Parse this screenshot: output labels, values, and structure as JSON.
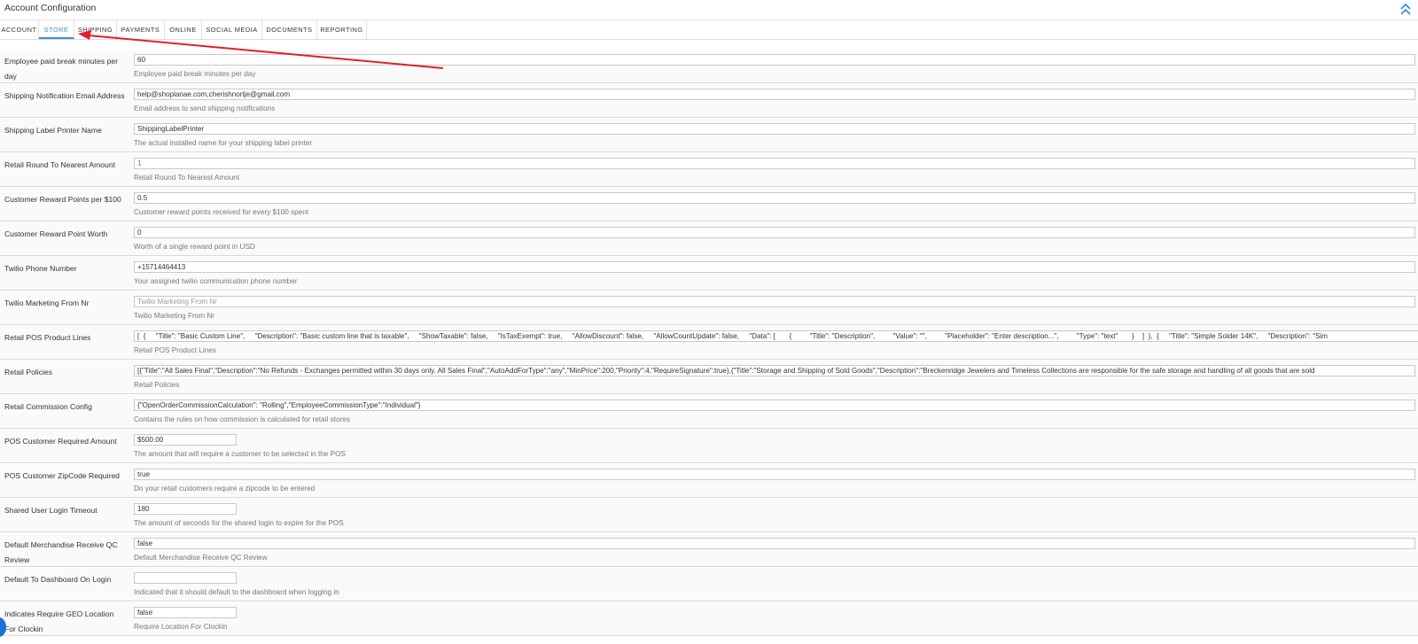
{
  "header": {
    "title": "Account Configuration"
  },
  "tabs": [
    {
      "label": "ACCOUNT"
    },
    {
      "label": "STORE"
    },
    {
      "label": "SHIPPING"
    },
    {
      "label": "PAYMENTS"
    },
    {
      "label": "ONLINE"
    },
    {
      "label": "SOCIAL MEDIA"
    },
    {
      "label": "DOCUMENTS"
    },
    {
      "label": "REPORTING"
    }
  ],
  "active_tab": "STORE",
  "colors": {
    "accent": "#3f8fd3",
    "annotation_arrow": "#e0202a"
  },
  "rows": [
    {
      "label": "Employee paid break minutes per day",
      "value": "60",
      "placeholder": "",
      "help": "Employee paid break minutes per day"
    },
    {
      "label": "Shipping Notification Email Address",
      "value": "help@shoplanae.com,cherishnortje@gmail.com",
      "placeholder": "",
      "help": "Email address to send shipping notifications"
    },
    {
      "label": "Shipping Label Printer Name",
      "value": "ShippingLabelPrinter",
      "placeholder": "",
      "help": "The actual installed name for your shipping label printer"
    },
    {
      "label": "Retail Round To Nearest Amount",
      "value": "1",
      "placeholder": "",
      "help": "Retail Round To Nearest Amount"
    },
    {
      "label": "Customer Reward Points per $100",
      "value": "0.5",
      "placeholder": "",
      "help": "Customer reward points received for every $100 spent"
    },
    {
      "label": "Customer Reward Point Worth",
      "value": "0",
      "placeholder": "",
      "help": "Worth of a single reward point in USD"
    },
    {
      "label": "Twilio Phone Number",
      "value": "+15714464413",
      "placeholder": "",
      "help": "Your assigned twilio communication phone number"
    },
    {
      "label": "Twilio Marketing From Nr",
      "value": "",
      "placeholder": "Twilio Marketing From Nr",
      "help": "Twilio Marketing From Nr"
    },
    {
      "label": "Retail POS Product Lines",
      "value": "[  {     \"Title\": \"Basic Custom Line\",     \"Description\": \"Basic custom line that is taxable\",     \"ShowTaxable\": false,     \"IsTaxExempt\": true,     \"AllowDiscount\": false,     \"AllowCountUpdate\": false,     \"Data\": [       {         \"Title\": \"Description\",         \"Value\": \"\",         \"Placeholder\": \"Enter description...\",         \"Type\": \"text\"       }    ]  },  {     \"Title\": \"Simple Solder 14K\",     \"Description\": \"Sim",
      "placeholder": "",
      "help": "Retail POS Product Lines"
    },
    {
      "label": "Retail Policies",
      "value": "[{\"Title\":\"All Sales Final\",\"Description\":\"No Refunds - Exchanges permitted within 30 days only. All Sales Final\",\"AutoAddForType\":\"any\",\"MinPrice\":200,\"Priority\":4,\"RequireSignature\":true},{\"Title\":\"Storage and Shipping of Sold Goods\",\"Description\":\"Breckenridge Jewelers and Timeless Collections are responsible for the safe storage and handling of all goods that are sold",
      "placeholder": "",
      "help": "Retail Policies"
    },
    {
      "label": "Retail Commission Config",
      "value": "{\"OpenOrderCommissionCalculation\": \"Rolling\",\"EmployeeCommissionType\":\"Individual\"}",
      "placeholder": "",
      "help": "Contains the rules on how commission is calculated for retail stores"
    },
    {
      "label": "POS Customer Required Amount",
      "value": "$500.00",
      "placeholder": "",
      "help": "The amount that will require a customer to be selected in the POS"
    },
    {
      "label": "POS Customer ZipCode Required",
      "value": "true",
      "placeholder": "",
      "help": "Do your retail customers require a zipcode to be entered"
    },
    {
      "label": "Shared User Login Timeout",
      "value": "180",
      "placeholder": "",
      "help": "The amount of seconds for the shared login to expire for the POS"
    },
    {
      "label": "Default Merchandise Receive QC Review",
      "value": "false",
      "placeholder": "",
      "help": "Default Merchandise Receive QC Review"
    },
    {
      "label": "Default To Dashboard On Login",
      "value": "",
      "placeholder": "",
      "help": "Indicated that it should default to the dashboard when logging in"
    },
    {
      "label": "Indicates Require GEO Location For Clockin",
      "value": "false",
      "placeholder": "",
      "help": "Require Location For Clockin"
    }
  ]
}
